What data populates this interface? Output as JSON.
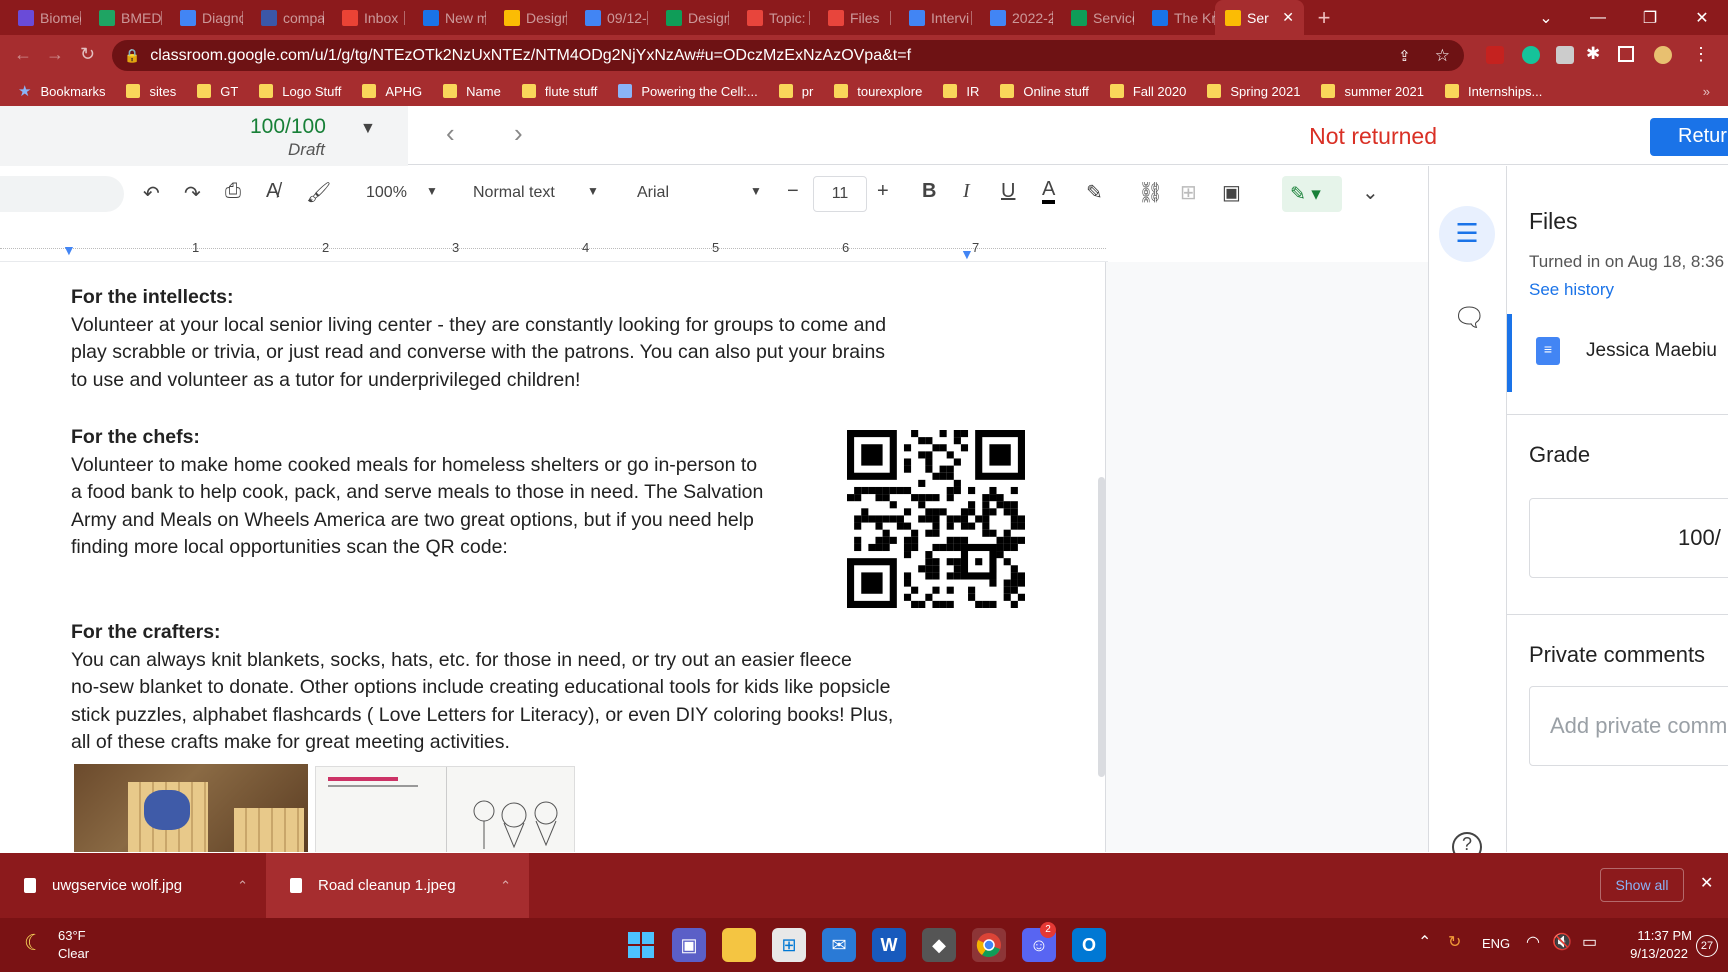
{
  "tabs": [
    {
      "label": "Biomed",
      "color": "#6a4bd8"
    },
    {
      "label": "BMED",
      "color": "#1fa463"
    },
    {
      "label": "Diagno",
      "color": "#4285f4"
    },
    {
      "label": "compa",
      "color": "#3b57a8"
    },
    {
      "label": "Inbox",
      "color": "#ea4335"
    },
    {
      "label": "New m",
      "color": "#1a73e8"
    },
    {
      "label": "Design",
      "color": "#fbbc04"
    },
    {
      "label": "09/12-",
      "color": "#4285f4"
    },
    {
      "label": "Design",
      "color": "#0f9d58"
    },
    {
      "label": "Topic:",
      "color": "#e8453c"
    },
    {
      "label": "Files",
      "color": "#e8453c"
    },
    {
      "label": "Intervi",
      "color": "#4285f4"
    },
    {
      "label": "2022-2",
      "color": "#4285f4"
    },
    {
      "label": "Service",
      "color": "#0f9d58"
    },
    {
      "label": "The Kr",
      "color": "#1a73e8"
    }
  ],
  "active_tab": {
    "label": "Ser"
  },
  "url": "classroom.google.com/u/1/g/tg/NTEzOTk2NzUxNTEz/NTM4ODg2NjYxNzAw#u=ODczMzExNzAzOVpa&t=f",
  "bookmarks": {
    "title": "Bookmarks",
    "items": [
      "sites",
      "GT",
      "Logo Stuff",
      "APHG",
      "Name",
      "flute stuff",
      "Powering the Cell:...",
      "pr",
      "tourexplore",
      "IR",
      "Online stuff",
      "Fall 2020",
      "Spring 2021",
      "summer 2021",
      "Internships..."
    ]
  },
  "grade_header": {
    "score": "100/100",
    "status": "Draft",
    "not_returned": "Not returned",
    "return_label": "Retur"
  },
  "toolbar": {
    "zoom": "100%",
    "style": "Normal text",
    "font": "Arial",
    "font_size": "11"
  },
  "ruler": {
    "numbers": [
      "1",
      "2",
      "3",
      "4",
      "5",
      "6",
      "7"
    ]
  },
  "doc": {
    "sections": [
      {
        "heading": "For the intellects:",
        "lines": [
          "Volunteer at your local senior living center - they are constantly looking for groups to come and",
          "play scrabble or trivia, or just read and converse with the patrons. You can also put your brains",
          "to use and volunteer as a tutor for underprivileged children!"
        ]
      },
      {
        "heading": "For the chefs:",
        "lines": [
          "Volunteer to make home cooked meals for homeless shelters or go in-person to",
          "a food bank to help cook, pack, and serve meals to those in need. The Salvation",
          "Army and Meals on Wheels America are two great options, but if you need help",
          "finding more local opportunities scan the QR code:"
        ]
      },
      {
        "heading": "For the crafters:",
        "lines": [
          "You can always knit blankets, socks, hats, etc. for those in need, or try out an easier fleece",
          "no-sew blanket to donate. Other options include creating educational tools for kids like popsicle",
          "stick puzzles, alphabet flashcards ( Love Letters for Literacy), or even DIY coloring books! Plus,",
          "all of these crafts make for great meeting activities."
        ]
      }
    ]
  },
  "files_panel": {
    "title": "Files",
    "turned_in": "Turned in on Aug 18, 8:36",
    "see_history": "See history",
    "file_name": "Jessica Maebiu",
    "grade_title": "Grade",
    "grade_value": "100/",
    "private_comments_title": "Private comments",
    "private_comment_placeholder": "Add private comm"
  },
  "downloads": {
    "items": [
      "uwgservice wolf.jpg",
      "Road cleanup 1.jpeg"
    ],
    "show_all": "Show all"
  },
  "taskbar": {
    "weather_temp": "63°F",
    "weather_desc": "Clear",
    "lang": "ENG",
    "time": "11:37 PM",
    "date": "9/13/2022",
    "notification_count": "27",
    "discord_badge": "2"
  }
}
